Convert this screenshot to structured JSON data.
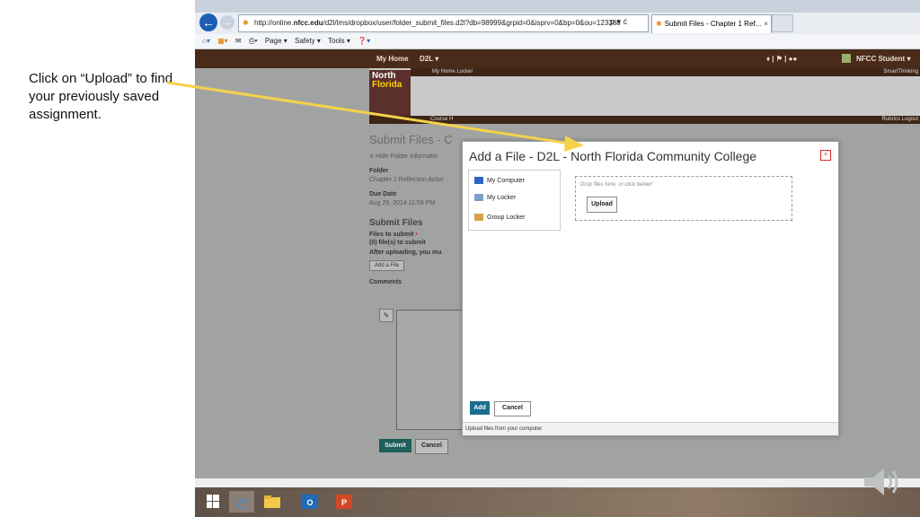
{
  "annotation": {
    "text": "Click on “Upload” to find your previously saved assignment."
  },
  "browser": {
    "url_prefix": "http://online.",
    "url_domain": "nfcc.edu",
    "url_rest": "/d2l/lms/dropbox/user/folder_submit_files.d2l?db=98999&grpid=0&isprv=0&bp=0&ou=123388",
    "address_tools": "ρ ▾ ć",
    "tab_title": "Submit Files - Chapter 1 Ref...",
    "tab_close": "×",
    "command_bar": {
      "page": "Page ▾",
      "safety": "Safety ▾",
      "tools": "Tools ▾"
    }
  },
  "d2l": {
    "my_home": "My Home",
    "d2l_menu": "D2L ▾",
    "user_menu": "NFCC Student ▾",
    "banner_link": "My Home  Locker",
    "smart_thinking": "SmartThinking",
    "course_home": "Course H",
    "rubrics_logout": "Rubrics  Logout",
    "logo_line1": "North",
    "logo_line2": "Florida",
    "page_heading": "Submit Files - C",
    "hide_folder": "∨  Hide Folder Informatio",
    "folder_label": "Folder",
    "folder_value": "Chapter 1 Reflection Activi",
    "due_label": "Due Date",
    "due_value": "Aug 29, 2014 11:59 PM",
    "submit_files_heading": "Submit Files",
    "files_to_submit_label": "Files to submit",
    "required_marker": "•",
    "files_count": "(0) file(s) to submit",
    "after_uploading": "After uploading, you mu",
    "add_a_file": "Add a File",
    "comments_label": "Comments",
    "submit_button": "Submit",
    "cancel_button": "Cancel"
  },
  "modal": {
    "title": "Add a File - D2L - North Florida Community College",
    "close": "×",
    "nav": [
      "My Computer",
      "My Locker",
      "Group Locker"
    ],
    "drop_hint": "Drop files here, or click below!",
    "upload_button": "Upload",
    "add_button": "Add",
    "cancel_button": "Cancel",
    "status": "Upload files from your computer."
  },
  "colors": {
    "annotation_arrow": "#f4d24a",
    "d2l_nav_bg": "#4a2b1a",
    "submit_button_bg": "#1d5f5a",
    "add_button_bg": "#1a6e8f",
    "close_icon": "#cc2b2b"
  }
}
